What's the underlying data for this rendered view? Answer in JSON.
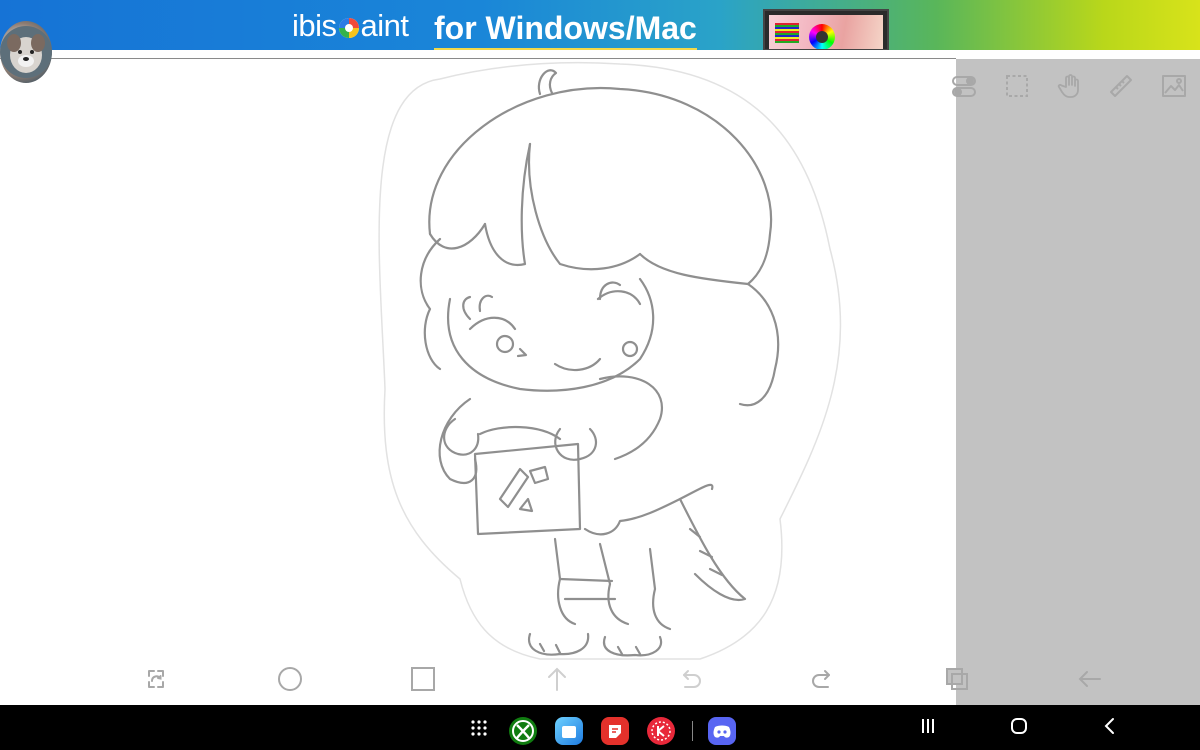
{
  "ad": {
    "brand_prefix": "ibis",
    "brand_suffix": "aint",
    "tagline": "for Windows/Mac"
  },
  "toolbar_top": [
    "layer-toggle-icon",
    "selection-icon",
    "hand-icon",
    "ruler-icon",
    "image-icon"
  ],
  "toolbar_bottom": [
    "transform-icon",
    "circle-icon",
    "square-icon",
    "arrow-up-icon",
    "undo-icon",
    "redo-icon",
    "layers-icon",
    "back-icon"
  ],
  "dock": [
    "apps-grid-icon",
    "xbox-app",
    "files-app",
    "notes-app",
    "kinemaster-app",
    "discord-app"
  ],
  "nav_buttons": [
    "recents-icon",
    "home-icon",
    "back-nav-icon"
  ],
  "colors": {
    "banner_start": "#1673d6",
    "banner_end": "#d8e31a",
    "panel_gray": "#c2c2c2",
    "icon_gray": "#a8a8a8",
    "line_art": "#8f8f8f"
  }
}
